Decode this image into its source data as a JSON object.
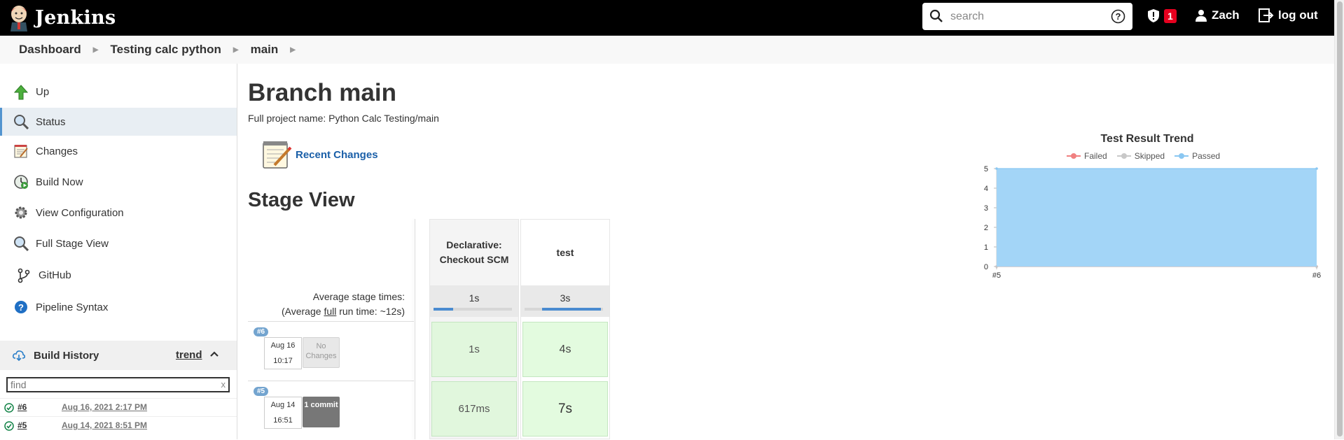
{
  "header": {
    "logo_text": "Jenkins",
    "search_placeholder": "search",
    "alert_count": "1",
    "user_name": "Zach",
    "logout_label": "log out"
  },
  "breadcrumb": [
    "Dashboard",
    "Testing calc python",
    "main"
  ],
  "sidebar": {
    "items": [
      {
        "label": "Up",
        "icon": "up-arrow-icon"
      },
      {
        "label": "Status",
        "icon": "magnifier-icon"
      },
      {
        "label": "Changes",
        "icon": "notepad-icon"
      },
      {
        "label": "Build Now",
        "icon": "clock-play-icon"
      },
      {
        "label": "View Configuration",
        "icon": "gear-icon"
      },
      {
        "label": "Full Stage View",
        "icon": "magnifier-icon"
      },
      {
        "label": "GitHub",
        "icon": "branch-icon"
      },
      {
        "label": "Pipeline Syntax",
        "icon": "help-icon"
      }
    ],
    "build_history": {
      "title": "Build History",
      "trend_label": "trend",
      "filter_placeholder": "find",
      "filter_clear": "x",
      "builds": [
        {
          "number": "#6",
          "date": "Aug 16, 2021 2:17 PM",
          "status": "success"
        },
        {
          "number": "#5",
          "date": "Aug 14, 2021 8:51 PM",
          "status": "success"
        }
      ]
    }
  },
  "main": {
    "title": "Branch main",
    "full_name": "Full project name: Python Calc Testing/main",
    "recent_changes_label": "Recent Changes",
    "stage_view_title": "Stage View",
    "avg_stage_times": "Average stage times:",
    "avg_full_prefix": "(Average ",
    "avg_full_word": "full",
    "avg_full_suffix": " run time: ~12s)",
    "stages": [
      {
        "name": "Declarative: Checkout SCM",
        "avg": "1s",
        "avg_fraction": 0.25
      },
      {
        "name": "test",
        "avg": "3s",
        "avg_fraction": 0.75
      }
    ],
    "runs": [
      {
        "badge": "#6",
        "month_day": "Aug 16",
        "time": "10:17",
        "changes": "No Changes",
        "has_changes": false,
        "durations": [
          "1s",
          "4s"
        ]
      },
      {
        "badge": "#5",
        "month_day": "Aug 14",
        "time": "16:51",
        "changes": "1 commit",
        "has_changes": true,
        "durations": [
          "617ms",
          "7s"
        ]
      }
    ]
  },
  "chart_data": {
    "type": "area",
    "title": "Test Result Trend",
    "x": [
      "#5",
      "#6"
    ],
    "series": [
      {
        "name": "Failed",
        "values": [
          0,
          0
        ],
        "color": "#f08080"
      },
      {
        "name": "Skipped",
        "values": [
          0,
          0
        ],
        "color": "#c8c8c8"
      },
      {
        "name": "Passed",
        "values": [
          5,
          5
        ],
        "color": "#8ac7f2"
      }
    ],
    "yticks": [
      0,
      1,
      2,
      3,
      4,
      5
    ],
    "ylim": [
      0,
      5
    ],
    "legend_position": "top"
  },
  "colors": {
    "header_bg": "#000000",
    "passed_fill": "#a3d5f7",
    "stage_success": "#e1f7dd",
    "alert_red": "#e6001f",
    "link_blue": "#1a5fa8"
  }
}
